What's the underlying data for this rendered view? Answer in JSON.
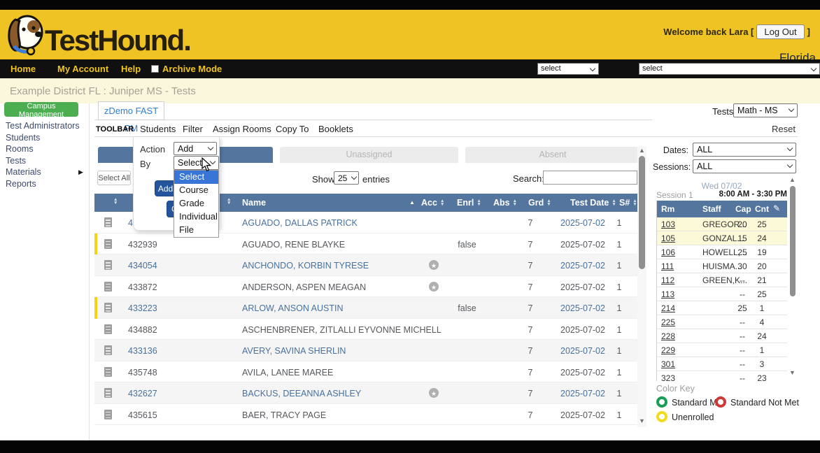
{
  "header": {
    "brand": "TestHound.",
    "welcome_prefix": "Welcome back Lara [",
    "logout_label": "Log Out",
    "welcome_suffix": "]",
    "region": "Florida"
  },
  "nav": {
    "items": [
      "Home",
      "My Account",
      "Help"
    ],
    "archive_label": "Archive Mode",
    "select1_value": "select",
    "select2_value": "select"
  },
  "breadcrumb": "Example District FL : Juniper MS - Tests",
  "sidebar": {
    "campus_button": "Campus Management",
    "items": [
      "Test Administrators",
      "Students",
      "Rooms",
      "Tests",
      "Materials",
      "Reports"
    ]
  },
  "main": {
    "test_tab": "zDemo FAST PM",
    "tests_label": "Tests:",
    "tests_value": "Math - MS",
    "toolbar_label": "TOOLBAR",
    "menu": [
      "Students",
      "Filter",
      "Assign Rooms",
      "Copy To",
      "Booklets"
    ],
    "reset_label": "Reset",
    "dropdown": {
      "action_label": "Action",
      "action_value": "Add",
      "by_label": "By",
      "by_value": "Select",
      "options": [
        "Select",
        "Course",
        "Grade",
        "Individual",
        "File"
      ],
      "add_button": "Add",
      "cancel_button": "Cancel"
    },
    "status_tabs": [
      "",
      "Unassigned",
      "Absent"
    ],
    "select_all": "Select All",
    "show_label": "Show",
    "show_value": "25",
    "entries_label": "entries",
    "search_label": "Search:",
    "table": {
      "name_header": "Name",
      "headers": [
        "Acc",
        "Enrl",
        "Abs",
        "Grd",
        "Test Date",
        "S#"
      ],
      "rows": [
        {
          "id": "431711",
          "name": "AGUADO, DALLAS PATRICK",
          "acc": false,
          "enrl": "",
          "grd": "7",
          "date": "2025-07-02",
          "s": "1",
          "flag": false
        },
        {
          "id": "432939",
          "name": "AGUADO, RENE BLAYKE",
          "acc": false,
          "enrl": "false",
          "grd": "7",
          "date": "2025-07-02",
          "s": "1",
          "flag": true
        },
        {
          "id": "434054",
          "name": "ANCHONDO, KORBIN TYRESE",
          "acc": true,
          "enrl": "",
          "grd": "7",
          "date": "2025-07-02",
          "s": "1",
          "flag": false
        },
        {
          "id": "433872",
          "name": "ANDERSON, ASPEN MEAGAN",
          "acc": true,
          "enrl": "",
          "grd": "7",
          "date": "2025-07-02",
          "s": "1",
          "flag": false
        },
        {
          "id": "433223",
          "name": "ARLOW, ANSON AUSTIN",
          "acc": false,
          "enrl": "false",
          "grd": "7",
          "date": "2025-07-02",
          "s": "1",
          "flag": true
        },
        {
          "id": "434882",
          "name": "ASCHENBRENER, ZITLALLI EYVONNE MICHELL",
          "acc": false,
          "enrl": "",
          "grd": "7",
          "date": "2025-07-02",
          "s": "1",
          "flag": false
        },
        {
          "id": "433136",
          "name": "AVERY, SAVINA SHERLIN",
          "acc": false,
          "enrl": "",
          "grd": "7",
          "date": "2025-07-02",
          "s": "1",
          "flag": false
        },
        {
          "id": "435748",
          "name": "AVILA, LANEE MAREE",
          "acc": false,
          "enrl": "",
          "grd": "7",
          "date": "2025-07-02",
          "s": "1",
          "flag": false
        },
        {
          "id": "432627",
          "name": "BACKUS, DEEANNA ASHLEY",
          "acc": true,
          "enrl": "",
          "grd": "7",
          "date": "2025-07-02",
          "s": "1",
          "flag": false
        },
        {
          "id": "435615",
          "name": "BAER, TRACY PAGE",
          "acc": false,
          "enrl": "",
          "grd": "7",
          "date": "2025-07-02",
          "s": "1",
          "flag": false
        }
      ]
    }
  },
  "right": {
    "dates_label": "Dates:",
    "dates_value": "ALL",
    "sessions_label": "Sessions:",
    "sessions_value": "ALL",
    "date_header": "Wed 07/02",
    "session_label": "Session 1",
    "session_time": "8:00 AM - 3:30 PM",
    "table_headers": [
      "Rm",
      "Staff",
      "Cap",
      "Cnt"
    ],
    "rooms": [
      {
        "rm": "103",
        "staff": "GREGOR...",
        "cap": "20",
        "cnt": "25",
        "hl": true
      },
      {
        "rm": "105",
        "staff": "GONZAL...",
        "cap": "15",
        "cnt": "24",
        "hl": true
      },
      {
        "rm": "106",
        "staff": "HOWELL,...",
        "cap": "25",
        "cnt": "19",
        "hl": false
      },
      {
        "rm": "111",
        "staff": "HUISMA...",
        "cap": "30",
        "cnt": "20",
        "hl": false
      },
      {
        "rm": "112",
        "staff": "GREEN,K...",
        "cap": "--",
        "cnt": "21",
        "hl": false
      },
      {
        "rm": "113",
        "staff": "",
        "cap": "--",
        "cnt": "25",
        "hl": false
      },
      {
        "rm": "214",
        "staff": "",
        "cap": "25",
        "cnt": "1",
        "hl": false
      },
      {
        "rm": "225",
        "staff": "",
        "cap": "--",
        "cnt": "4",
        "hl": false
      },
      {
        "rm": "228",
        "staff": "",
        "cap": "--",
        "cnt": "24",
        "hl": false
      },
      {
        "rm": "229",
        "staff": "",
        "cap": "--",
        "cnt": "1",
        "hl": false
      },
      {
        "rm": "301",
        "staff": "",
        "cap": "--",
        "cnt": "3",
        "hl": false
      },
      {
        "rm": "323",
        "staff": "",
        "cap": "--",
        "cnt": "23",
        "hl": false
      }
    ],
    "color_key": {
      "title": "Color Key",
      "items": [
        {
          "label": "Standard Met",
          "color": "#1a9e53"
        },
        {
          "label": "Standard Not Met",
          "color": "#cf3838"
        },
        {
          "label": "Unenrolled",
          "color": "#f2dc1e"
        }
      ]
    }
  },
  "colors": {
    "header_yellow": "#f0c325",
    "nav_black": "#101010",
    "table_header_blue": "#54769e",
    "campus_green": "#4cae50",
    "button_blue": "#24549c",
    "highlight_blue": "#3875d6",
    "flag_yellow": "#f5d312",
    "room_highlight": "#fcf9d8"
  }
}
